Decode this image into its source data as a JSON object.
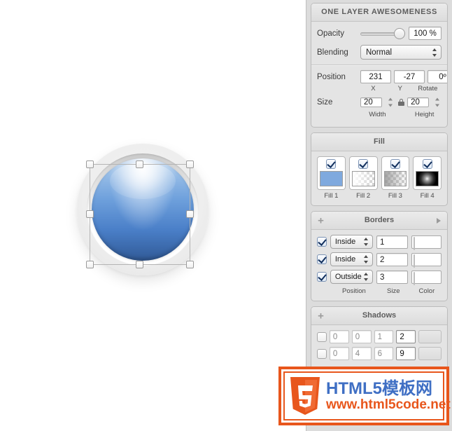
{
  "canvas": {
    "object_name": "blue-glossy-button",
    "selection_handles": 8
  },
  "inspector": {
    "title": "ONE LAYER AWESOMENESS",
    "opacity": {
      "label": "Opacity",
      "value": "100 %",
      "slider_percent": 100
    },
    "blending": {
      "label": "Blending",
      "value": "Normal"
    },
    "position": {
      "label": "Position",
      "x": "231",
      "y": "-27",
      "rotate": "0º",
      "sub_x": "X",
      "sub_y": "Y",
      "sub_rotate": "Rotate"
    },
    "size": {
      "label": "Size",
      "width": "20",
      "height": "20",
      "sub_width": "Width",
      "sub_height": "Height",
      "lock_icon": "lock-icon"
    },
    "fill": {
      "title": "Fill",
      "items": [
        {
          "label": "Fill 1",
          "checked": true,
          "swatch": "solid-blue",
          "color": "#7fa9de"
        },
        {
          "label": "Fill 2",
          "checked": true,
          "swatch": "checker-white-gradient"
        },
        {
          "label": "Fill 3",
          "checked": true,
          "swatch": "checker-gray-gradient"
        },
        {
          "label": "Fill 4",
          "checked": true,
          "swatch": "black-radial-glow",
          "color": "#000000"
        }
      ]
    },
    "borders": {
      "title": "Borders",
      "add_icon": "plus-icon",
      "disclosure_icon": "chevron-right-icon",
      "sub_position": "Position",
      "sub_size": "Size",
      "sub_color": "Color",
      "rows": [
        {
          "checked": true,
          "position": "Inside",
          "size": "1",
          "color_swatch": "light-gray-gradient"
        },
        {
          "checked": true,
          "position": "Inside",
          "size": "2",
          "color_swatch": "checker-gradient"
        },
        {
          "checked": true,
          "position": "Outside",
          "size": "3",
          "color_swatch": "light-gray-gradient"
        }
      ]
    },
    "shadows": {
      "title": "Shadows",
      "add_icon": "plus-icon",
      "rows": [
        {
          "checked": false,
          "f1": "0",
          "f2": "0",
          "f3": "1",
          "f4": "2",
          "color_swatch": "light-gray"
        },
        {
          "checked": false,
          "f1": "0",
          "f2": "4",
          "f3": "6",
          "f4": "9",
          "color_swatch": "light-gray"
        }
      ]
    }
  },
  "watermark": {
    "logo": "html5-shield-icon",
    "line1": "HTML5模板网",
    "line2": "www.html5code.net",
    "border_color": "#e8561c",
    "text_color": "#3f6fc4"
  }
}
